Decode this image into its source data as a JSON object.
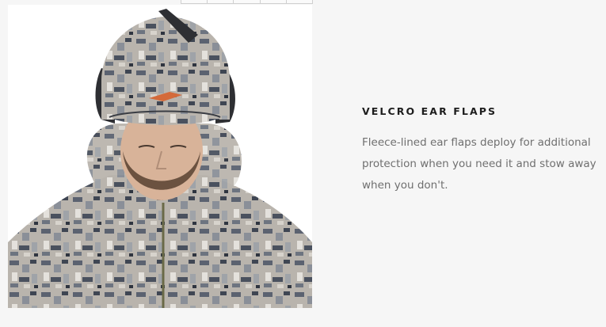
{
  "feature": {
    "title": "VELCRO EAR FLAPS",
    "description": "Fleece-lined ear flaps deploy for additional protection when you need it and stow away when you don't."
  },
  "thumbnails": {
    "count": 5
  }
}
